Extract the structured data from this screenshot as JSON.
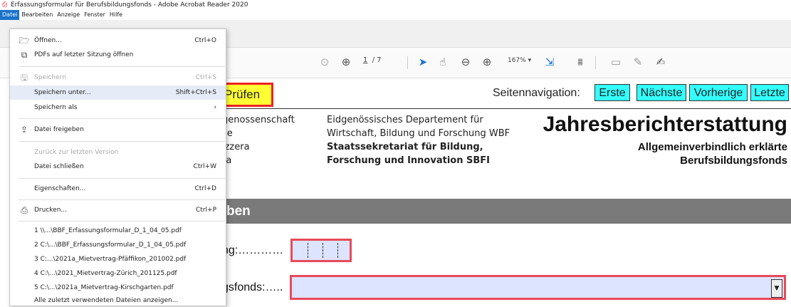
{
  "window": {
    "title": "Erfassungsformular für Berufsbildungsfonds - Adobe Acrobat Reader 2020"
  },
  "menubar": [
    "Datei",
    "Bearbeiten",
    "Anzeige",
    "Fenster",
    "Hilfe"
  ],
  "toolbar": {
    "page_current": "1",
    "page_total": "/ 7",
    "zoom": "167%"
  },
  "file_menu": {
    "items": [
      {
        "label": "Öffnen...",
        "shortcut": "Ctrl+O",
        "icon": "folder-open-icon",
        "disabled": false
      },
      {
        "label": "PDFs auf letzter Sitzung öffnen",
        "shortcut": "",
        "icon": "pdf-stack-icon",
        "disabled": false
      },
      {
        "label": "Speichern",
        "shortcut": "Ctrl+S",
        "icon": "save-icon",
        "disabled": true
      },
      {
        "label": "Speichern unter...",
        "shortcut": "Shift+Ctrl+S",
        "icon": "",
        "disabled": false,
        "highlighted": true
      },
      {
        "label": "Speichern als",
        "shortcut": "›",
        "icon": "",
        "disabled": false
      },
      {
        "label": "Datei freigeben",
        "shortcut": "",
        "icon": "share-icon",
        "disabled": false
      },
      {
        "label": "Zurück zur letzten Version",
        "shortcut": "",
        "icon": "",
        "disabled": true
      },
      {
        "label": "Datei schließen",
        "shortcut": "Ctrl+W",
        "icon": "",
        "disabled": false
      },
      {
        "label": "Eigenschaften...",
        "shortcut": "Ctrl+D",
        "icon": "",
        "disabled": false
      },
      {
        "label": "Drucken...",
        "shortcut": "Ctrl+P",
        "icon": "printer-icon",
        "disabled": false
      }
    ],
    "recent_files": [
      "1 \\\\...\\BBF_Erfassungsformular_D_1_04_05.pdf",
      "2 C:\\...\\BBF_Erfassungsformular_D_1_04_05.pdf",
      "3 C:...\\2021a_Mietvertrag-Pfäffikon_201002.pdf",
      "4 C:\\...\\2021_Mietvertrag-Zürich_201125.pdf",
      "5 C:\\...\\2021a_Mietvertrag-Kirschgarten.pdf",
      "Alle zuletzt verwendeten Dateien anzeigen..."
    ]
  },
  "document": {
    "check_button": "Prüfen",
    "navigation_label": "Seitennavigation:",
    "nav_buttons": [
      "Erste",
      "Nächste",
      "Vorherige",
      "Letzte"
    ],
    "confed_lines": [
      "genossenschaft",
      "se",
      "izzera",
      "ra"
    ],
    "department_lines": [
      "Eidgenössisches Departement für",
      "Wirtschaft, Bildung und Forschung WBF"
    ],
    "secretariat_lines": [
      "Staatssekretariat für Bildung,",
      "Forschung und Innovation SBFI"
    ],
    "main_title": "Jahresberichterstattung",
    "subtitle_lines": [
      "Allgemeinverbindlich erklärte",
      "Berufsbildungsfonds"
    ],
    "section_heading": "ben",
    "field1_label": "ng:…………",
    "field2_label": "gsfonds:…..",
    "colors": {
      "check_bg": "#ffff33",
      "nav_bg": "#33ffff",
      "field_border": "#e84a5a",
      "field_bg": "#dde4ff"
    }
  }
}
